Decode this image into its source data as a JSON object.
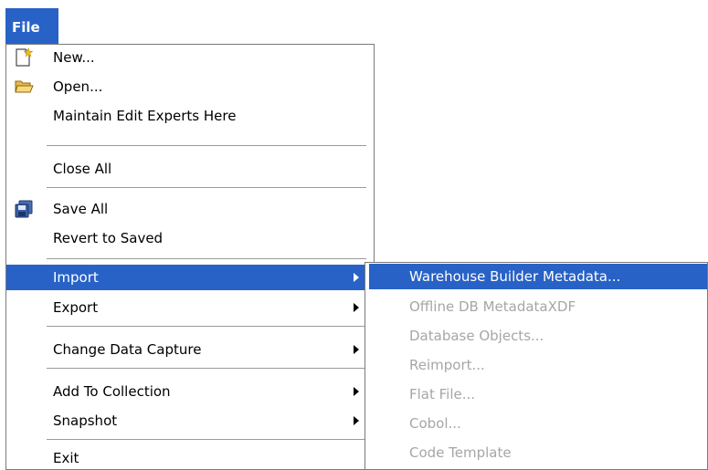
{
  "menubar": {
    "file_label": "File"
  },
  "file_menu": {
    "items": [
      {
        "label": "New...",
        "icon": "new-file-icon"
      },
      {
        "label": "Open...",
        "icon": "folder-open-icon"
      },
      {
        "label": "Maintain Edit Experts Here"
      },
      {
        "label": "Close All"
      },
      {
        "label": "Save All",
        "icon": "save-all-icon"
      },
      {
        "label": "Revert to Saved"
      },
      {
        "label": "Import",
        "has_submenu": true,
        "selected": true
      },
      {
        "label": "Export",
        "has_submenu": true
      },
      {
        "label": "Change Data Capture",
        "has_submenu": true
      },
      {
        "label": "Add To Collection",
        "has_submenu": true
      },
      {
        "label": "Snapshot",
        "has_submenu": true
      },
      {
        "label": "Exit"
      }
    ]
  },
  "import_submenu": {
    "items": [
      {
        "label": "Warehouse Builder Metadata...",
        "enabled": true,
        "selected": true
      },
      {
        "label": "Offline DB MetadataXDF",
        "enabled": false
      },
      {
        "label": "Database Objects...",
        "enabled": false
      },
      {
        "label": "Reimport...",
        "enabled": false
      },
      {
        "label": "Flat File...",
        "enabled": false
      },
      {
        "label": "Cobol...",
        "enabled": false
      },
      {
        "label": "Code Template",
        "enabled": false
      }
    ]
  },
  "colors": {
    "selection": "#2862c6",
    "disabled_text": "#a6a6a6",
    "separator": "#9a9a9a"
  }
}
